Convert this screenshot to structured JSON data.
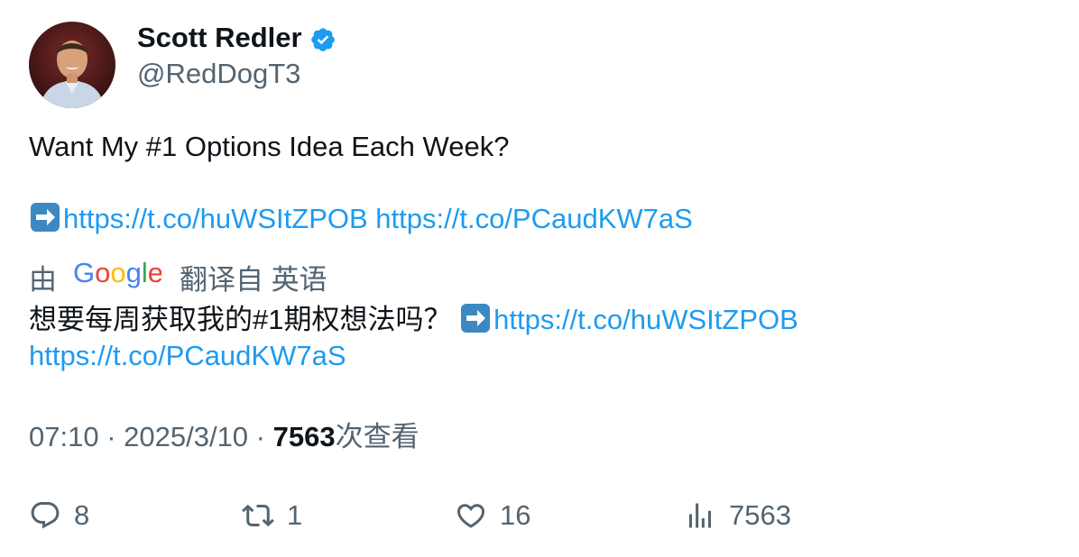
{
  "author": {
    "name": "Scott Redler",
    "handle": "@RedDogT3",
    "verified": true
  },
  "tweet": {
    "text_line1": "Want My #1 Options Idea Each Week?",
    "link1": "https://t.co/huWSItZPOB",
    "link2": "https://t.co/PCaudKW7aS",
    "arrow_icon": "right-arrow-emoji"
  },
  "translation": {
    "prefix": "由",
    "provider": "Google",
    "suffix": "翻译自 英语",
    "text": "想要每周获取我的#1期权想法吗？",
    "link1": "https://t.co/huWSItZPOB",
    "link2": "https://t.co/PCaudKW7aS"
  },
  "meta": {
    "time": "07:10",
    "sep1": " · ",
    "date": "2025/3/10",
    "sep2": " · ",
    "views": "7563",
    "views_label": "次查看"
  },
  "actions": {
    "replies": "8",
    "retweets": "1",
    "likes": "16",
    "views": "7563"
  },
  "colors": {
    "link": "#1d9bf0",
    "secondary_text": "#536471",
    "primary_text": "#0f1419",
    "verified_badge": "#1d9bf0"
  }
}
